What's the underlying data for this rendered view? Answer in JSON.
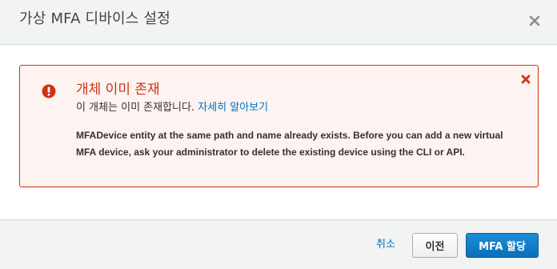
{
  "dialog": {
    "title": "가상 MFA 디바이스 설정",
    "close_icon": "close-icon"
  },
  "alert": {
    "title": "개체 이미 존재",
    "subtitle_text": "이 개체는 이미 존재합니다.",
    "learn_more": "자세히 알아보기",
    "body_line1": "MFADevice entity at the same path and name already exists. Before you can add a new virtual",
    "body_line2": "MFA device, ask your administrator to delete the existing device using the CLI or API.",
    "error_icon": "error-icon",
    "dismiss_icon": "dismiss-icon",
    "color": "#d13212"
  },
  "footer": {
    "cancel_label": "취소",
    "previous_label": "이전",
    "assign_label": "MFA 할당",
    "primary_color": "#0a6fb8"
  }
}
